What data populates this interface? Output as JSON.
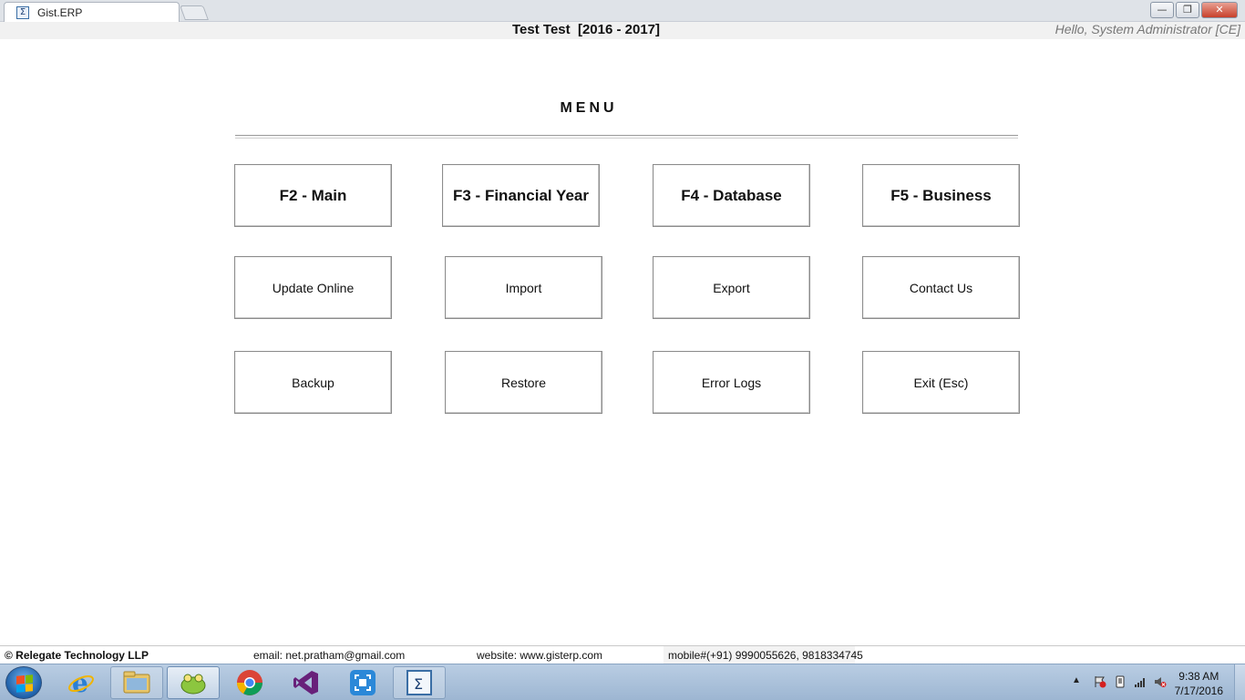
{
  "browser": {
    "tab_title": "Gist.ERP",
    "tab_icon": "sigma-icon"
  },
  "header": {
    "company": "Test Test  [2016 - 2017]",
    "greeting": "Hello, System Administrator [CE]"
  },
  "menu": {
    "title": "MENU",
    "rows": [
      [
        "F2 - Main",
        "F3 - Financial Year",
        "F4 - Database",
        "F5 - Business"
      ],
      [
        "Update Online",
        "Import",
        "Export",
        "Contact Us"
      ],
      [
        "Backup",
        "Restore",
        "Error Logs",
        "Exit (Esc)"
      ]
    ]
  },
  "footer": {
    "copyright": "© Relegate Technology LLP",
    "email": "email:  net.pratham@gmail.com",
    "website": "website: www.gisterp.com",
    "mobile": "mobile#(+91) 9990055626, 9818334745"
  },
  "taskbar": {
    "apps": [
      "internet-explorer",
      "file-explorer",
      "toad",
      "chrome",
      "visual-studio",
      "screen-capture",
      "gist-erp"
    ],
    "time": "9:38 AM",
    "date": "7/17/2016"
  },
  "colors": {
    "button_border": "#8c8c8c",
    "taskbar": "#b9cde3",
    "close_button": "#c8402a"
  }
}
